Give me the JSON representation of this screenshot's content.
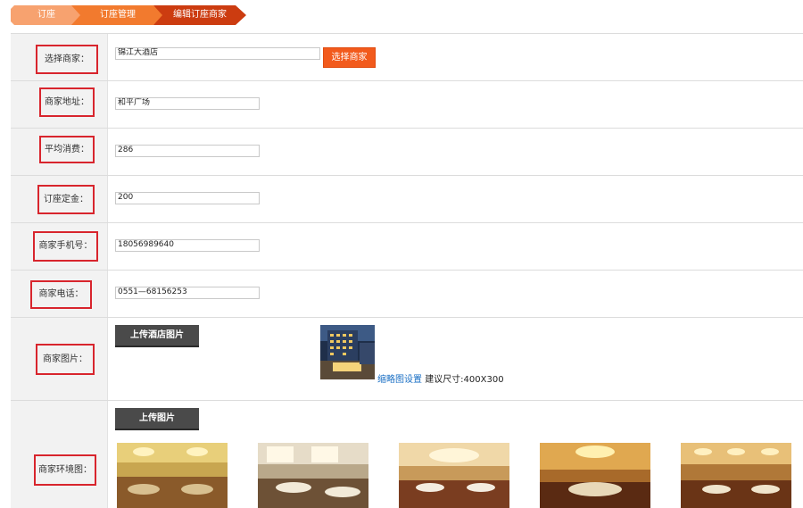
{
  "breadcrumb": [
    "订座",
    "订座管理",
    "编辑订座商家"
  ],
  "colors": {
    "accent": "#f25a1c",
    "label_border": "#d8252d",
    "dark_button": "#4a4a4a",
    "link": "#1a6fc4"
  },
  "fields": {
    "merchant": {
      "label": "选择商家：",
      "value": "锦江大酒店",
      "button": "选择商家"
    },
    "address": {
      "label": "商家地址：",
      "value": "和平广场"
    },
    "avg_cost": {
      "label": "平均消费：",
      "value": "286"
    },
    "deposit": {
      "label": "订座定金：",
      "value": "200"
    },
    "mobile": {
      "label": "商家手机号：",
      "value": "18056989640"
    },
    "phone": {
      "label": "商家电话：",
      "value": "0551—68156253"
    },
    "image": {
      "label": "商家图片：",
      "button": "上传酒店图片",
      "thumb_link": "缩略图设置",
      "hint": "建议尺寸:400X300"
    },
    "env": {
      "label": "商家环境图：",
      "button": "上传图片"
    }
  }
}
